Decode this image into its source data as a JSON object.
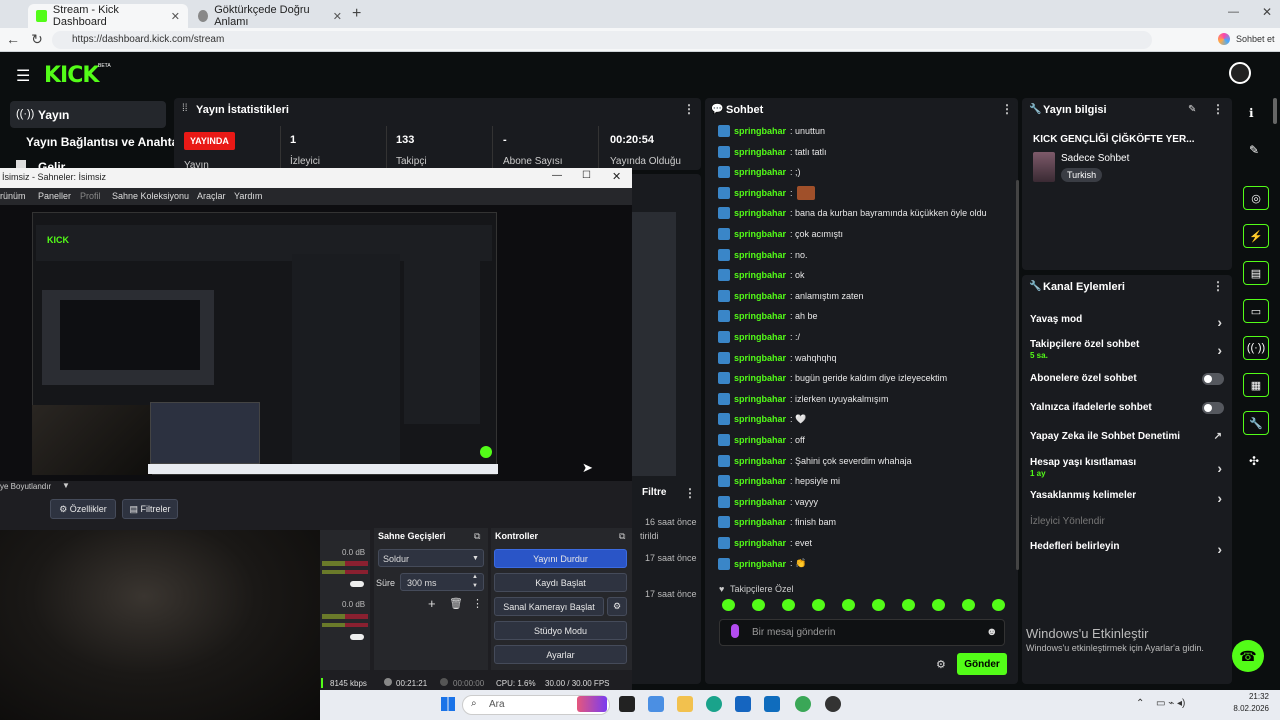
{
  "browser": {
    "tabs": [
      {
        "title": "Stream - Kick Dashboard"
      },
      {
        "title": "Göktürkçede Doğru Anlamı"
      }
    ],
    "url": "https://dashboard.kick.com/stream",
    "copilot_label": "Sohbet et"
  },
  "kick": {
    "logo": "KICK",
    "beta": "BETA",
    "sidebar": {
      "items": [
        {
          "label": "Yayın",
          "icon": "broadcast-icon"
        },
        {
          "label": "Yayın Bağlantısı ve Anahtarı"
        },
        {
          "label": "Gelir"
        }
      ]
    },
    "stats": {
      "title": "Yayın İstatistikleri",
      "badge": "YAYINDA",
      "badge_label": "Yayın",
      "cells": [
        {
          "value": "1",
          "label": "İzleyici"
        },
        {
          "value": "133",
          "label": "Takipçi"
        },
        {
          "value": "-",
          "label": "Abone Sayısı"
        },
        {
          "value": "00:20:54",
          "label": "Yayında Olduğu"
        }
      ]
    },
    "chat": {
      "title": "Sohbet",
      "messages": [
        {
          "user": "springbahar",
          "text": ": unuttun"
        },
        {
          "user": "springbahar",
          "text": ": tatlı tatlı"
        },
        {
          "user": "springbahar",
          "text": ": ;)"
        },
        {
          "user": "springbahar",
          "text": ":",
          "emote": true
        },
        {
          "user": "springbahar",
          "text": ": bana da kurban bayramında küçükken öyle oldu"
        },
        {
          "user": "springbahar",
          "text": ": çok acımıştı"
        },
        {
          "user": "springbahar",
          "text": ": no."
        },
        {
          "user": "springbahar",
          "text": ": ok"
        },
        {
          "user": "springbahar",
          "text": ": anlamıştım zaten"
        },
        {
          "user": "springbahar",
          "text": ": ah be"
        },
        {
          "user": "springbahar",
          "text": ": :/"
        },
        {
          "user": "springbahar",
          "text": ": wahqhqhq"
        },
        {
          "user": "springbahar",
          "text": ": bugün geride kaldım diye izleyecektim"
        },
        {
          "user": "springbahar",
          "text": ": izlerken uyuyakalmışım"
        },
        {
          "user": "springbahar",
          "text": ": 🤍"
        },
        {
          "user": "springbahar",
          "text": ": off"
        },
        {
          "user": "springbahar",
          "text": ": Şahini çok severdim whahaja"
        },
        {
          "user": "springbahar",
          "text": ": hepsiyle mi"
        },
        {
          "user": "springbahar",
          "text": ": vayyy"
        },
        {
          "user": "springbahar",
          "text": ": finish bam"
        },
        {
          "user": "springbahar",
          "text": ": evet"
        },
        {
          "user": "springbahar",
          "text": ": 👏"
        }
      ],
      "follower_label": "Takipçilere Özel",
      "input_placeholder": "Bir mesaj gönderin",
      "send_label": "Gönder"
    },
    "stream_info": {
      "title": "Yayın bilgisi",
      "stream_title": "KICK GENÇLİĞİ ÇİĞKÖFTE YER...",
      "category": "Sadece Sohbet",
      "language": "Turkish"
    },
    "channel_actions": {
      "title": "Kanal Eylemleri",
      "items": [
        {
          "label": "Yavaş mod",
          "control": "chevron"
        },
        {
          "label": "Takipçilere özel sohbet",
          "sub": "5 sa.",
          "control": "chevron"
        },
        {
          "label": "Abonelere özel sohbet",
          "control": "toggle"
        },
        {
          "label": "Yalnızca ifadelerle sohbet",
          "control": "toggle"
        },
        {
          "label": "Yapay Zeka ile Sohbet Denetimi",
          "control": "external"
        },
        {
          "label": "Hesap yaşı kısıtlaması",
          "sub": "1 ay",
          "control": "chevron"
        },
        {
          "label": "Yasaklanmış kelimeler",
          "control": "chevron"
        },
        {
          "label": "İzleyici Yönlendir",
          "control": "none",
          "disabled": true
        },
        {
          "label": "Hedefleri belirleyin",
          "control": "chevron"
        }
      ]
    },
    "watermark": {
      "title": "Windows'u Etkinleştir",
      "sub": "Windows'u etkinleştirmek için Ayarlar'a gidin."
    }
  },
  "obs": {
    "window_title": "İsimsiz - Sahneler: İsimsiz",
    "menu": [
      "rünüm",
      "Paneller",
      "Profil",
      "Sahne Koleksiyonu",
      "Araçlar",
      "Yardım"
    ],
    "source_label": "ye Boyutlandır",
    "properties_label": "Özellikler",
    "filters_label": "Filtreler",
    "filter_panel_label": "Filtre",
    "audio": {
      "db1": "0.0 dB",
      "db2": "0.0 dB"
    },
    "transitions": {
      "title": "Sahne Geçişleri",
      "type": "Soldur",
      "duration_label": "Süre",
      "duration": "300 ms"
    },
    "controls": {
      "title": "Kontroller",
      "buttons": [
        "Yayını Durdur",
        "Kaydı Başlat",
        "Sanal Kamerayı Başlat",
        "Stüdyo Modu",
        "Ayarlar"
      ]
    },
    "status": {
      "kbps": "8145 kbps",
      "live_time": "00:21:21",
      "rec_time": "00:00:00",
      "cpu": "CPU: 1.6%",
      "fps": "30.00 / 30.00 FPS"
    },
    "log": [
      {
        "time": "16 saat önce",
        "text": "tirildi"
      },
      {
        "time": "17 saat önce",
        "text": ""
      },
      {
        "time": "17 saat önce",
        "text": ""
      }
    ]
  },
  "taskbar": {
    "search_placeholder": "Ara",
    "time": "21:32",
    "date": "8.02.2026"
  }
}
